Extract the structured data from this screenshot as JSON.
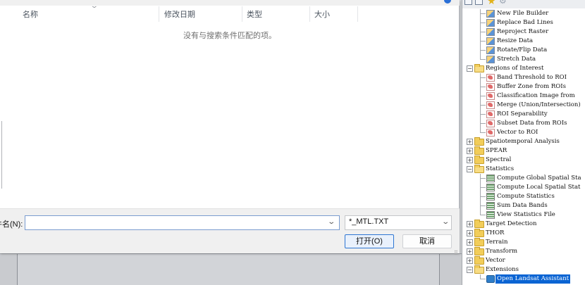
{
  "dialog": {
    "columns": [
      "名称",
      "修改日期",
      "类型",
      "大小"
    ],
    "empty_message": "没有与搜索条件匹配的项。",
    "filename_label": "件名(N):",
    "filename_value": "",
    "filetype_value": "*_MTL.TXT",
    "open_label": "打开(O)",
    "cancel_label": "取消"
  },
  "toolbox": {
    "items": [
      {
        "kind": "leaf",
        "icon": "tool-icon",
        "label": "New File Builder"
      },
      {
        "kind": "leaf",
        "icon": "tool-icon",
        "label": "Replace Bad Lines"
      },
      {
        "kind": "leaf",
        "icon": "tool-icon",
        "label": "Reproject Raster"
      },
      {
        "kind": "leaf",
        "icon": "tool-icon",
        "label": "Resize Data"
      },
      {
        "kind": "leaf",
        "icon": "tool-icon",
        "label": "Rotate/Flip Data"
      },
      {
        "kind": "leaf",
        "icon": "tool-icon",
        "label": "Stretch Data"
      },
      {
        "kind": "folder",
        "expanded": true,
        "label": "Regions of Interest"
      },
      {
        "kind": "leaf",
        "icon": "roi-icon",
        "label": "Band Threshold to ROI"
      },
      {
        "kind": "leaf",
        "icon": "roi-icon",
        "label": "Buffer Zone from ROIs"
      },
      {
        "kind": "leaf",
        "icon": "roi-icon",
        "label": "Classification Image from"
      },
      {
        "kind": "leaf",
        "icon": "roi-icon",
        "label": "Merge (Union/Intersection)"
      },
      {
        "kind": "leaf",
        "icon": "roi-icon",
        "label": "ROI Separability"
      },
      {
        "kind": "leaf",
        "icon": "roi-icon",
        "label": "Subset Data from ROIs"
      },
      {
        "kind": "leaf",
        "icon": "roi-icon",
        "label": "Vector to ROI"
      },
      {
        "kind": "folder",
        "expanded": false,
        "label": "Spatiotemporal Analysis"
      },
      {
        "kind": "folder",
        "expanded": false,
        "label": "SPEAR"
      },
      {
        "kind": "folder",
        "expanded": false,
        "label": "Spectral"
      },
      {
        "kind": "folder",
        "expanded": true,
        "label": "Statistics"
      },
      {
        "kind": "leaf",
        "icon": "statistics-icon",
        "label": "Compute Global Spatial Sta"
      },
      {
        "kind": "leaf",
        "icon": "statistics-icon",
        "label": "Compute Local Spatial Stat"
      },
      {
        "kind": "leaf",
        "icon": "statistics-icon",
        "label": "Compute Statistics"
      },
      {
        "kind": "leaf",
        "icon": "statistics-icon",
        "label": "Sum Data Bands"
      },
      {
        "kind": "leaf",
        "icon": "statistics-icon",
        "label": "View Statistics File"
      },
      {
        "kind": "folder",
        "expanded": false,
        "label": "Target Detection"
      },
      {
        "kind": "folder",
        "expanded": false,
        "label": "THOR"
      },
      {
        "kind": "folder",
        "expanded": false,
        "label": "Terrain"
      },
      {
        "kind": "folder",
        "expanded": false,
        "label": "Transform"
      },
      {
        "kind": "folder",
        "expanded": false,
        "label": "Vector"
      },
      {
        "kind": "folder",
        "expanded": true,
        "label": "Extensions"
      },
      {
        "kind": "leaf",
        "icon": "landsat-icon",
        "label": "Open Landsat Assistant",
        "selected": true
      }
    ]
  },
  "colors": {
    "selection": "#0a64d3",
    "open_button_border": "#2d75d2",
    "folder": "#f2cd5a"
  }
}
